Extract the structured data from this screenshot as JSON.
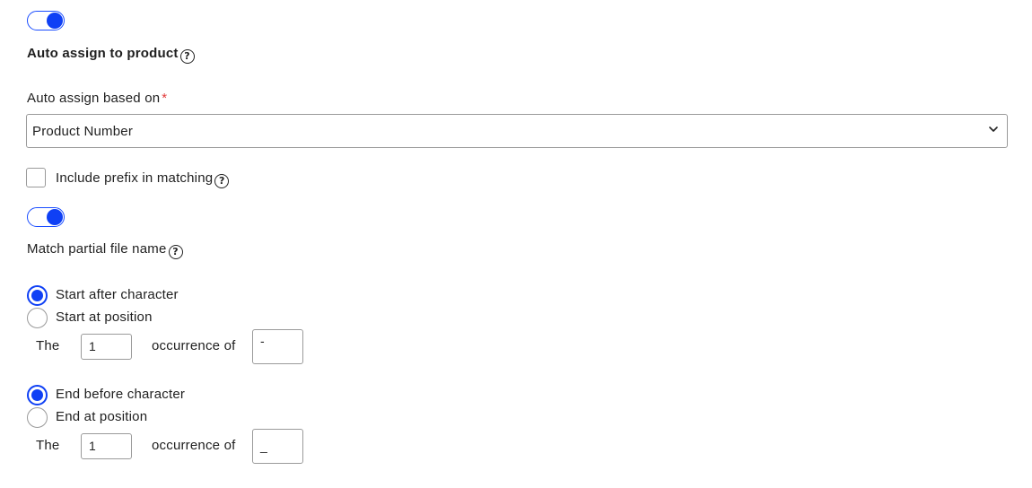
{
  "auto_assign_toggle": {
    "on": true
  },
  "auto_assign_heading": "Auto assign to product",
  "auto_assign_help": "?",
  "based_on": {
    "label": "Auto assign based on",
    "required_marker": "*",
    "selected": "Product Number"
  },
  "include_prefix": {
    "label": "Include prefix in matching",
    "checked": false
  },
  "partial_toggle": {
    "on": true
  },
  "partial": {
    "label": "Match partial file name"
  },
  "start": {
    "options": [
      "Start after character",
      "Start at position"
    ],
    "selected_index": 0,
    "the_label": "The",
    "occurrence_value": "1",
    "occurrence_label": "occurrence of",
    "char_value": "-"
  },
  "end": {
    "options": [
      "End before character",
      "End at position"
    ],
    "selected_index": 0,
    "the_label": "The",
    "occurrence_value": "1",
    "occurrence_label": "occurrence of",
    "char_value": "_"
  },
  "colors": {
    "accent": "#0f40f5",
    "required": "#e23a3a",
    "border": "#9a9a9a"
  },
  "icons": {
    "select_chevron": "chevron-down-icon",
    "help": "help-circle-icon"
  }
}
